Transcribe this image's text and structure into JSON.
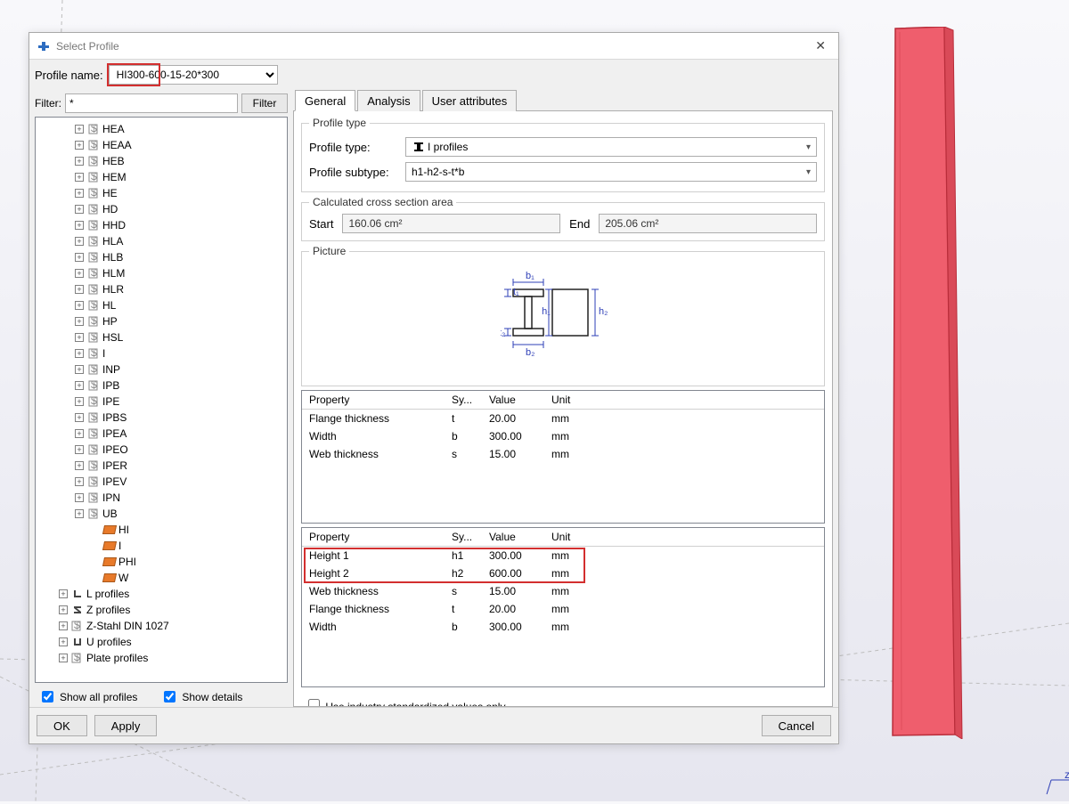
{
  "dialog": {
    "title": "Select Profile",
    "close_glyph": "✕",
    "profile_name_label": "Profile name:",
    "profile_name_value": "HI300-600-15-20*300",
    "filter_label": "Filter:",
    "filter_value": "*",
    "filter_button": "Filter",
    "show_all": "Show all profiles",
    "show_details": "Show details",
    "use_industry": "Use industry standardized values only",
    "ok": "OK",
    "apply": "Apply",
    "cancel": "Cancel"
  },
  "tabs": {
    "general": "General",
    "analysis": "Analysis",
    "user": "User attributes"
  },
  "profile_type": {
    "legend": "Profile type",
    "type_label": "Profile type:",
    "type_value": "I profiles",
    "subtype_label": "Profile subtype:",
    "subtype_value": "h1-h2-s-t*b"
  },
  "calc": {
    "legend": "Calculated cross section area",
    "start_label": "Start",
    "start_value": "160.06 cm²",
    "end_label": "End",
    "end_value": "205.06 cm²"
  },
  "picture": {
    "legend": "Picture",
    "labels": {
      "b1": "b₁",
      "b2": "b₂",
      "t1": "t₁",
      "t2": "t₂",
      "h1": "h₁",
      "h2": "h₂"
    }
  },
  "table_headers": {
    "property": "Property",
    "symbol": "Sy...",
    "value": "Value",
    "unit": "Unit"
  },
  "table1": {
    "rows": [
      {
        "p": "Flange thickness",
        "s": "t",
        "v": "20.00",
        "u": "mm"
      },
      {
        "p": "Width",
        "s": "b",
        "v": "300.00",
        "u": "mm"
      },
      {
        "p": "Web thickness",
        "s": "s",
        "v": "15.00",
        "u": "mm"
      }
    ]
  },
  "table2": {
    "rows": [
      {
        "p": "Height 1",
        "s": "h1",
        "v": "300.00",
        "u": "mm"
      },
      {
        "p": "Height 2",
        "s": "h2",
        "v": "600.00",
        "u": "mm"
      },
      {
        "p": "Web thickness",
        "s": "s",
        "v": "15.00",
        "u": "mm"
      },
      {
        "p": "Flange thickness",
        "s": "t",
        "v": "20.00",
        "u": "mm"
      },
      {
        "p": "Width",
        "s": "b",
        "v": "300.00",
        "u": "mm"
      }
    ]
  },
  "tree": {
    "i_children": [
      "HEA",
      "HEAA",
      "HEB",
      "HEM",
      "HE",
      "HD",
      "HHD",
      "HLA",
      "HLB",
      "HLM",
      "HLR",
      "HL",
      "HP",
      "HSL",
      "I",
      "INP",
      "IPB",
      "IPE",
      "IPBS",
      "IPEA",
      "IPEO",
      "IPER",
      "IPEV",
      "IPN",
      "UB"
    ],
    "leaf_children": [
      "HI",
      "I",
      "PHI",
      "W"
    ],
    "roots": [
      "L profiles",
      "Z profiles",
      "Z-Stahl DIN 1027",
      "U profiles",
      "Plate profiles"
    ]
  }
}
